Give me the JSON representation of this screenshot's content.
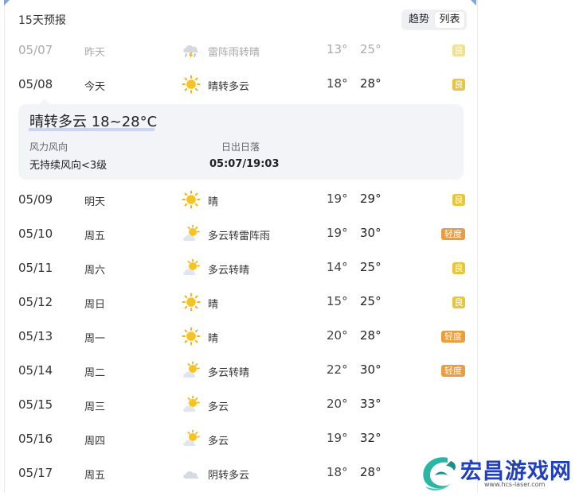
{
  "header": {
    "title": "15天预报",
    "tab_trend": "趋势",
    "tab_list": "列表"
  },
  "rows": [
    {
      "date": "05/07",
      "day": "昨天",
      "weather": "雷阵雨转晴",
      "icon": "thunder-rain-icon",
      "low": "13°",
      "high": "25°",
      "aqi": "良"
    },
    {
      "date": "05/08",
      "day": "今天",
      "weather": "晴转多云",
      "icon": "sunny-icon",
      "low": "18°",
      "high": "28°",
      "aqi": "良"
    },
    {
      "date": "05/09",
      "day": "明天",
      "weather": "晴",
      "icon": "sunny-icon",
      "low": "19°",
      "high": "29°",
      "aqi": "良"
    },
    {
      "date": "05/10",
      "day": "周五",
      "weather": "多云转雷阵雨",
      "icon": "partly-cloudy-icon",
      "low": "19°",
      "high": "30°",
      "aqi": "轻度"
    },
    {
      "date": "05/11",
      "day": "周六",
      "weather": "多云转晴",
      "icon": "partly-cloudy-icon",
      "low": "14°",
      "high": "25°",
      "aqi": "良"
    },
    {
      "date": "05/12",
      "day": "周日",
      "weather": "晴",
      "icon": "sunny-icon",
      "low": "15°",
      "high": "25°",
      "aqi": "良"
    },
    {
      "date": "05/13",
      "day": "周一",
      "weather": "晴",
      "icon": "sunny-icon",
      "low": "20°",
      "high": "28°",
      "aqi": "轻度"
    },
    {
      "date": "05/14",
      "day": "周二",
      "weather": "多云转晴",
      "icon": "partly-cloudy-icon",
      "low": "22°",
      "high": "30°",
      "aqi": "轻度"
    },
    {
      "date": "05/15",
      "day": "周三",
      "weather": "多云",
      "icon": "partly-cloudy-icon",
      "low": "20°",
      "high": "33°",
      "aqi": ""
    },
    {
      "date": "05/16",
      "day": "周四",
      "weather": "多云",
      "icon": "partly-cloudy-icon",
      "low": "19°",
      "high": "32°",
      "aqi": ""
    },
    {
      "date": "05/17",
      "day": "周五",
      "weather": "阴转多云",
      "icon": "overcast-icon",
      "low": "18°",
      "high": "28°",
      "aqi": ""
    }
  ],
  "detail": {
    "headline": "晴转多云 18~28°C",
    "wind_label": "风力风向",
    "wind_value": "无持续风向<3级",
    "sun_label": "日出日落",
    "sun_value": "05:07/19:03"
  },
  "watermark": {
    "brand": "宏昌游戏网",
    "site": "www.hcs-laser.com"
  },
  "colors": {
    "aqi_good": "#e7c53c",
    "aqi_light": "#eb9d3b",
    "detail_bg": "#f2f4f8",
    "sun": "#f5b414"
  }
}
